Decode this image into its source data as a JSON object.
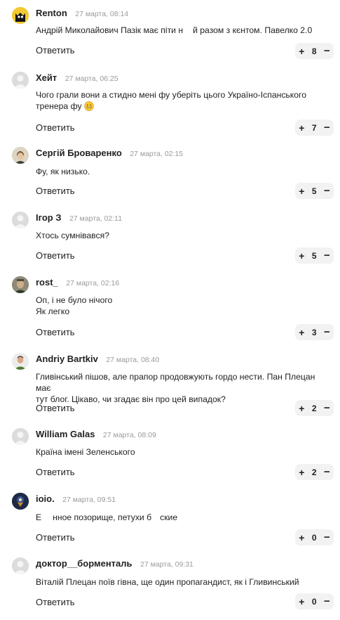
{
  "reply_label": "Ответить",
  "comments": [
    {
      "author": "Renton",
      "time": "27 марта, 08:14",
      "text_a": "Андрій Миколайович Пазік має піти н",
      "text_b": "й разом з кєнтом. Павелко 2.0",
      "votes": "8"
    },
    {
      "author": "Хейт",
      "time": "27 марта, 06:25",
      "text_line1": "Чого грали вони а стидно мені фу уберіть цього Україно-Іспанського",
      "text_line2": "тренера фу",
      "votes": "7",
      "emoji": "grinning-face-icon"
    },
    {
      "author": "Сергій Броваренко",
      "time": "27 марта, 02:15",
      "text": "Фу, як низько.",
      "votes": "5"
    },
    {
      "author": "Ігор З",
      "time": "27 марта, 02:11",
      "text": "Хтось сумнівався?",
      "votes": "5"
    },
    {
      "author": "rost_",
      "time": "27 марта, 02:16",
      "text_line1": "Оп, і не було нічого",
      "text_line2": "Як легко",
      "votes": "3"
    },
    {
      "author": "Andriy Bartkiv",
      "time": "27 марта, 08:40",
      "text_line1": "Гливінський пішов, але прапор продовжують гордо нести. Пан Плецан має",
      "text_line2": "тут блог. Цікаво, чи згадає він про цей випадок?",
      "votes": "2"
    },
    {
      "author": "William Galas",
      "time": "27 марта, 08:09",
      "text": "Країна імені Зеленського",
      "votes": "2"
    },
    {
      "author": "ioio.",
      "time": "27 марта, 09:51",
      "text_a": "Е",
      "text_b": "нное позорище, петухи б",
      "text_c": "ские",
      "votes": "0"
    },
    {
      "author": "доктор__борменталь",
      "time": "27 марта, 09:31",
      "text": "Віталій Плецан поїв гівна, ще один пропагандист, як і Гливинський",
      "votes": "0"
    }
  ],
  "colors": {
    "author": "#222222",
    "time": "#9a9a9a",
    "vote_bg": "#f2f2f2",
    "avatar_placeholder": "#dcdcdc"
  }
}
